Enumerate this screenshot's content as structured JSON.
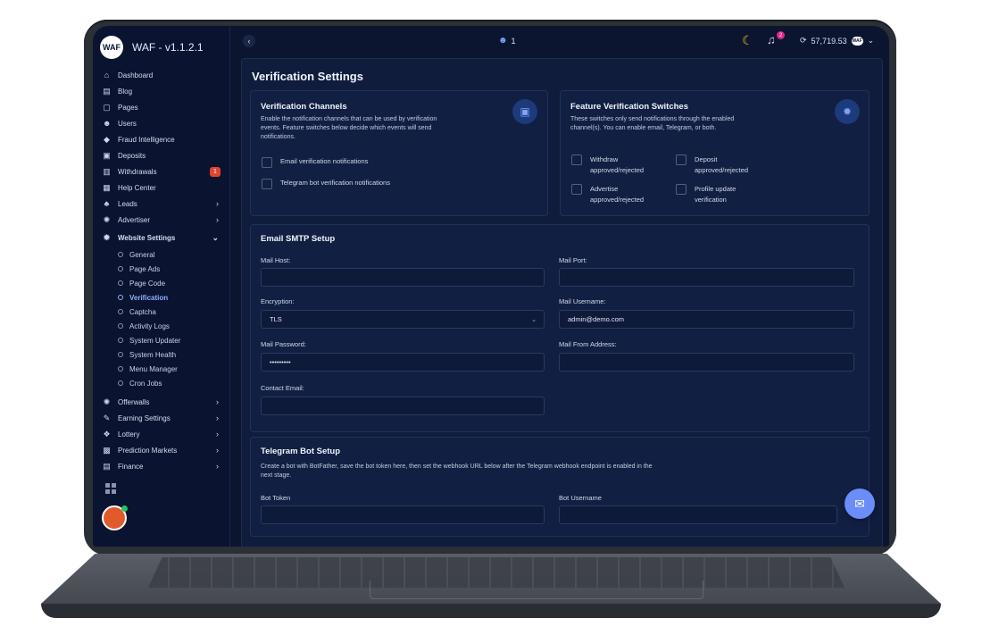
{
  "app": {
    "title": "WAF - v1.1.2.1",
    "logo_text": "WAF"
  },
  "sidebar": {
    "items": [
      {
        "label": "Dashboard",
        "icon": "home-icon",
        "glyph": "⌂"
      },
      {
        "label": "Blog",
        "icon": "blog-icon",
        "glyph": "▤"
      },
      {
        "label": "Pages",
        "icon": "pages-icon",
        "glyph": "▢"
      },
      {
        "label": "Users",
        "icon": "users-icon",
        "glyph": "☻"
      },
      {
        "label": "Fraud Intelligence",
        "icon": "fraud-icon",
        "glyph": "◆"
      },
      {
        "label": "Deposits",
        "icon": "deposits-icon",
        "glyph": "▣"
      },
      {
        "label": "Withdrawals",
        "icon": "withdrawals-icon",
        "glyph": "▥",
        "badge": "1"
      },
      {
        "label": "Help Center",
        "icon": "help-icon",
        "glyph": "▦"
      },
      {
        "label": "Leads",
        "icon": "leads-icon",
        "glyph": "♣",
        "chevron": "›"
      },
      {
        "label": "Advertiser",
        "icon": "advertiser-icon",
        "glyph": "✺",
        "chevron": "›"
      },
      {
        "label": "Website Settings",
        "icon": "settings-icon",
        "glyph": "✹",
        "chevron": "⌄"
      }
    ],
    "sub_items": [
      {
        "label": "General"
      },
      {
        "label": "Page Ads"
      },
      {
        "label": "Page Code"
      },
      {
        "label": "Verification",
        "active": true
      },
      {
        "label": "Captcha"
      },
      {
        "label": "Activity Logs"
      },
      {
        "label": "System Updater"
      },
      {
        "label": "System Health"
      },
      {
        "label": "Menu Manager"
      },
      {
        "label": "Cron Jobs"
      }
    ],
    "items_after": [
      {
        "label": "Offerwalls",
        "icon": "offerwalls-icon",
        "glyph": "✺",
        "chevron": "›"
      },
      {
        "label": "Earning Settings",
        "icon": "earning-icon",
        "glyph": "✎",
        "chevron": "›"
      },
      {
        "label": "Lottery",
        "icon": "lottery-icon",
        "glyph": "❖",
        "chevron": "›"
      },
      {
        "label": "Prediction Markets",
        "icon": "prediction-icon",
        "glyph": "▩",
        "chevron": "›"
      },
      {
        "label": "Finance",
        "icon": "finance-icon",
        "glyph": "▤",
        "chevron": "›"
      }
    ]
  },
  "topbar": {
    "collapse_glyph": "‹",
    "users_count": "1",
    "notifications_count": "2",
    "balance": "57,719.53",
    "balance_logo": "WAF"
  },
  "main": {
    "title": "Verification Settings",
    "channels": {
      "title": "Verification Channels",
      "description": "Enable the notification channels that can be used by verification events. Feature switches below decide which events will send notifications.",
      "options": [
        "Email verification notifications",
        "Telegram bot verification notifications"
      ]
    },
    "switches": {
      "title": "Feature Verification Switches",
      "description": "These switches only send notifications through the enabled channel(s). You can enable email, Telegram, or both.",
      "options": [
        "Withdraw approved/rejected",
        "Deposit approved/rejected",
        "Advertise approved/rejected",
        "Profile update verification"
      ]
    },
    "smtp": {
      "title": "Email SMTP Setup",
      "mail_host_label": "Mail Host:",
      "mail_host_value": "",
      "mail_port_label": "Mail Port:",
      "mail_port_value": "",
      "encryption_label": "Encryption:",
      "encryption_value": "TLS",
      "mail_username_label": "Mail Username:",
      "mail_username_value": "admin@demo.com",
      "mail_password_label": "Mail Password:",
      "mail_password_value": "•••••••••",
      "mail_from_label": "Mail From Address:",
      "mail_from_value": "",
      "contact_email_label": "Contact Email:",
      "contact_email_value": ""
    },
    "telegram": {
      "title": "Telegram Bot Setup",
      "description": "Create a bot with BotFather, save the bot token here, then set the webhook URL below after the Telegram webhook endpoint is enabled in the next stage.",
      "bot_token_label": "Bot Token",
      "bot_username_label": "Bot Username"
    }
  },
  "colors": {
    "accent": "#7fa2ff",
    "background": "#0b1530",
    "card": "#111f42",
    "badge": "#e0432f"
  }
}
